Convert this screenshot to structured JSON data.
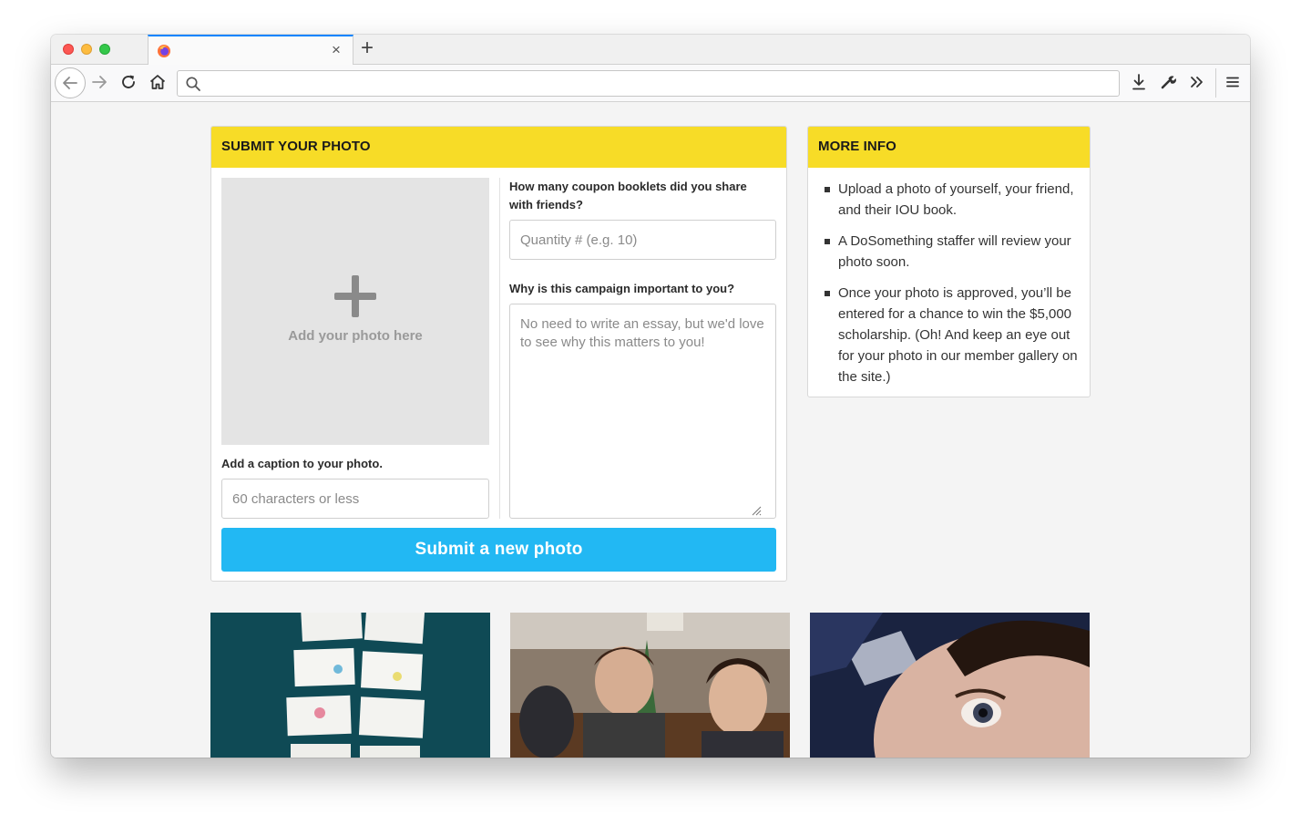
{
  "browser": {
    "tab": {
      "title": "",
      "close_glyph": "×"
    },
    "new_tab_glyph": "+",
    "urlbar": {
      "value": "",
      "placeholder": ""
    },
    "icons": [
      "back-arrow-icon",
      "forward-arrow-icon",
      "reload-icon",
      "home-icon",
      "search-icon",
      "download-icon",
      "wrench-icon",
      "overflow-chevrons-icon",
      "hamburger-menu-icon"
    ]
  },
  "submit_card": {
    "heading": "SUBMIT YOUR PHOTO",
    "photo_drop_label": "Add your photo here",
    "caption_label": "Add a caption to your photo.",
    "caption_placeholder": "60 characters or less",
    "quantity_label": "How many coupon booklets did you share with friends?",
    "quantity_placeholder": "Quantity # (e.g. 10)",
    "why_label": "Why is this campaign important to you?",
    "why_placeholder": "No need to write an essay, but we'd love to see why this matters to you!",
    "submit_label": "Submit a new photo"
  },
  "info_card": {
    "heading": "MORE INFO",
    "items": [
      "Upload a photo of yourself, your friend, and their IOU book.",
      "A DoSomething staffer will review your photo soon.",
      "Once your photo is approved, you’ll be entered for a chance to win the $5,000 scholarship. (Oh! And keep an eye out for your photo in our member gallery on the site.)"
    ]
  },
  "colors": {
    "header_yellow": "#f7dc27",
    "submit_blue": "#22b8f3",
    "tab_accent": "#0a84ff"
  }
}
